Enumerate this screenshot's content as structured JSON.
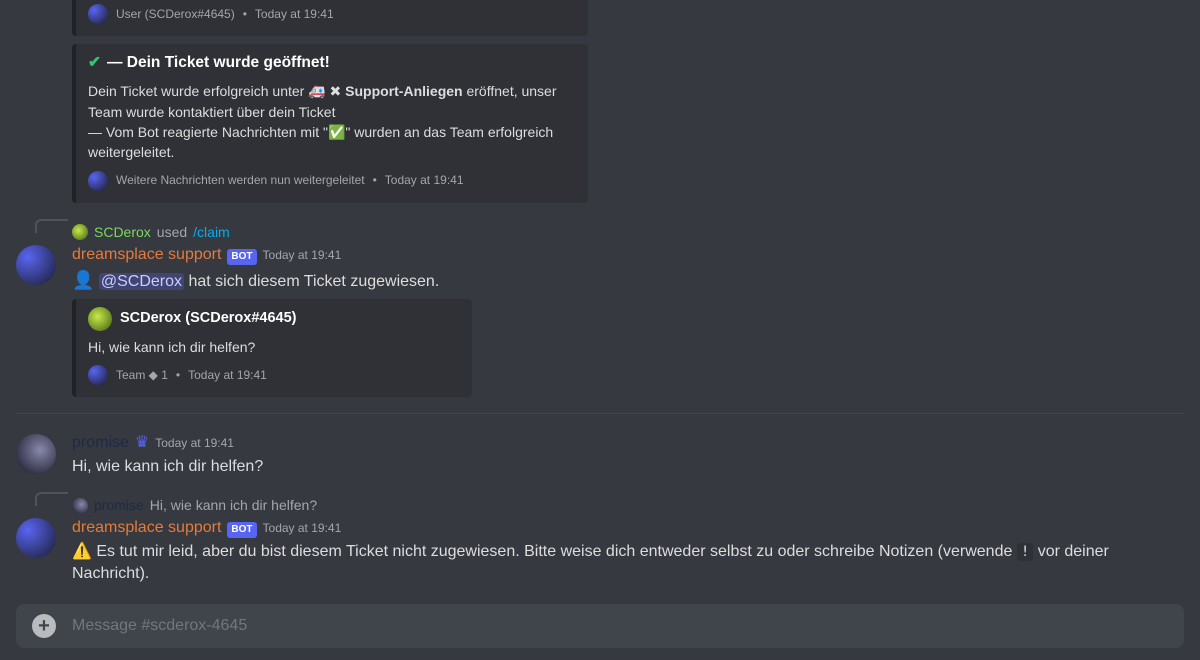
{
  "embeds": {
    "e1": {
      "footer_text": "User (SCDerox#4645)",
      "footer_time": "Today at 19:41"
    },
    "e2": {
      "title": "— Dein Ticket wurde geöffnet!",
      "desc_a": "Dein Ticket wurde erfolgreich unter 🚑 ✖ ",
      "desc_bold": "Support-Anliegen",
      "desc_b": " eröffnet, unser Team wurde kontaktiert über dein Ticket",
      "desc_c": "— Vom Bot reagierte Nachrichten mit \"✅\" wurden an das Team erfolgreich weitergeleitet.",
      "footer_text": "Weitere Nachrichten werden nun weitergeleitet",
      "footer_time": "Today at 19:41"
    },
    "e3": {
      "author": "SCDerox (SCDerox#4645)",
      "desc": "Hi, wie kann ich dir helfen?",
      "footer_text": "Team ◆ 1",
      "footer_time": "Today at 19:41"
    }
  },
  "msg1": {
    "reply_user": "SCDerox",
    "reply_action": " used ",
    "reply_cmd": "/claim",
    "username": "dreamsplace support",
    "bot": "BOT",
    "time": "Today at 19:41",
    "content_mention": "@SCDerox",
    "content_rest": " hat sich diesem Ticket zugewiesen."
  },
  "msg2": {
    "username": "promise",
    "time": "Today at 19:41",
    "content": "Hi, wie kann ich dir helfen?"
  },
  "msg3": {
    "reply_user": "promise",
    "reply_preview": "Hi, wie kann ich dir helfen?",
    "username": "dreamsplace support",
    "bot": "BOT",
    "time": "Today at 19:41",
    "content_a": "⚠️ Es tut mir leid, aber du bist diesem Ticket nicht zugewiesen. Bitte weise dich entweder selbst zu oder schreibe Notizen (verwende ",
    "content_code": "!",
    "content_b": " vor deiner Nachricht)."
  },
  "input": {
    "placeholder": "Message #scderox-4645"
  }
}
